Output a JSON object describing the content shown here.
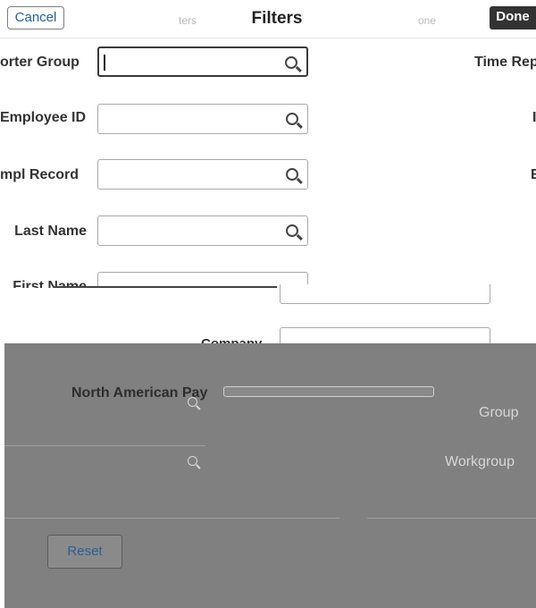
{
  "header": {
    "cancel_label": "Cancel",
    "title": "Filters",
    "done_label": "Done",
    "ghost_left": "ters",
    "ghost_right": "one"
  },
  "filters": [
    {
      "label": "orter Group",
      "value": ""
    },
    {
      "label": "Employee ID",
      "value": ""
    },
    {
      "label": "mpl Record",
      "value": ""
    },
    {
      "label": "Last Name",
      "value": ""
    },
    {
      "label": "First Name",
      "value": ""
    }
  ],
  "right_labels": {
    "time_rep": "Time Rep",
    "r2": "I",
    "r3": "E"
  },
  "lower_labels": {
    "company": "Company",
    "north_american_pay": "North American Pay",
    "group": "Group",
    "workgroup": "Workgroup"
  },
  "footer": {
    "reset_label": "Reset"
  },
  "icons": {
    "search": "search-icon"
  },
  "colors": {
    "overlay": "#808080",
    "done_bg": "#333333",
    "link": "#1f5fa8"
  }
}
